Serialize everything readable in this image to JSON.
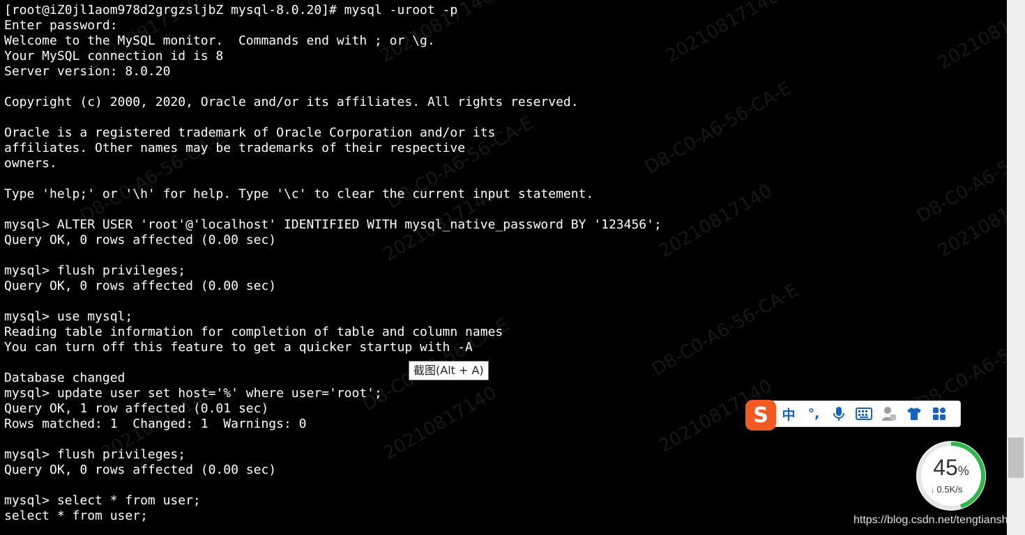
{
  "terminal": {
    "lines": [
      "[root@iZ0jl1aom978d2grgzsljbZ mysql-8.0.20]# mysql -uroot -p",
      "Enter password:",
      "Welcome to the MySQL monitor.  Commands end with ; or \\g.",
      "Your MySQL connection id is 8",
      "Server version: 8.0.20",
      "",
      "Copyright (c) 2000, 2020, Oracle and/or its affiliates. All rights reserved.",
      "",
      "Oracle is a registered trademark of Oracle Corporation and/or its",
      "affiliates. Other names may be trademarks of their respective",
      "owners.",
      "",
      "Type 'help;' or '\\h' for help. Type '\\c' to clear the current input statement.",
      "",
      "mysql> ALTER USER 'root'@'localhost' IDENTIFIED WITH mysql_native_password BY '123456';",
      "Query OK, 0 rows affected (0.00 sec)",
      "",
      "mysql> flush privileges;",
      "Query OK, 0 rows affected (0.00 sec)",
      "",
      "mysql> use mysql;",
      "Reading table information for completion of table and column names",
      "You can turn off this feature to get a quicker startup with -A",
      "",
      "Database changed",
      "mysql> update user set host='%' where user='root';",
      "Query OK, 1 row affected (0.01 sec)",
      "Rows matched: 1  Changed: 1  Warnings: 0",
      "",
      "mysql> flush privileges;",
      "Query OK, 0 rows affected (0.00 sec)",
      "",
      "mysql> select * from user;",
      "select * from user;"
    ],
    "watermark_mac": "D8-C0-A6-56-CA-E",
    "watermark_id": "20210817140",
    "colors": {
      "background": "#000000",
      "text": "#ffffff"
    }
  },
  "tooltip": {
    "text": "截图(Alt + A)"
  },
  "ime": {
    "logo": "S",
    "mode_label": "中",
    "punct_label": "°,",
    "icons": [
      "voice-mic-icon",
      "keyboard-icon",
      "user-icon",
      "skin-shirt-icon",
      "toolbox-grid-icon"
    ],
    "accent": "#1565c0",
    "logo_color": "#f15a22"
  },
  "gauge": {
    "percent": "45",
    "percent_unit": "%",
    "speed": "0.5K/s",
    "fill_fraction": 0.45,
    "ring_color": "#2db84d"
  },
  "source_url": "https://blog.csdn.net/tengtiansha"
}
